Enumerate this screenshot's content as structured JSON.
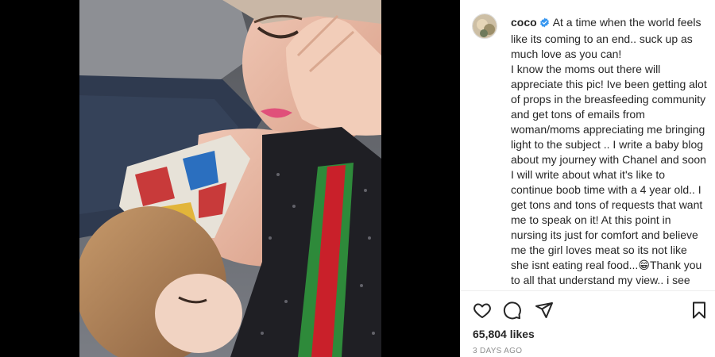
{
  "post": {
    "username": "coco",
    "caption_lines": [
      "At a time when the world feels like its coming to an end.. suck up as much love as you can!",
      "I know the moms out there will appreciate this pic! Ive been getting alot of props in the breasfeeding community and get tons of emails from woman/moms appreciating me bringing light to the subject .. I write a baby blog about my journey with Chanel and soon I will write about what it's like to continue boob time with a 4 year old.. I get tons and tons of requests that want me to speak on it! At this point in nursing its just for comfort and believe me the girl loves meat so its not like she isnt eating real food...",
      "Thank you to all that understand my view.. i see most of you are so eager to side with me and I"
    ],
    "emoji": "😁",
    "likes": "65,804 likes",
    "timestamp": "3 DAYS AGO"
  },
  "icons": {
    "like": "heart-icon",
    "comment": "comment-icon",
    "share": "paper-plane-icon",
    "save": "bookmark-icon",
    "verified": "verified-badge-icon"
  },
  "colors": {
    "verified_blue": "#3897f0",
    "text": "#262626",
    "muted": "#8e8e8e"
  }
}
